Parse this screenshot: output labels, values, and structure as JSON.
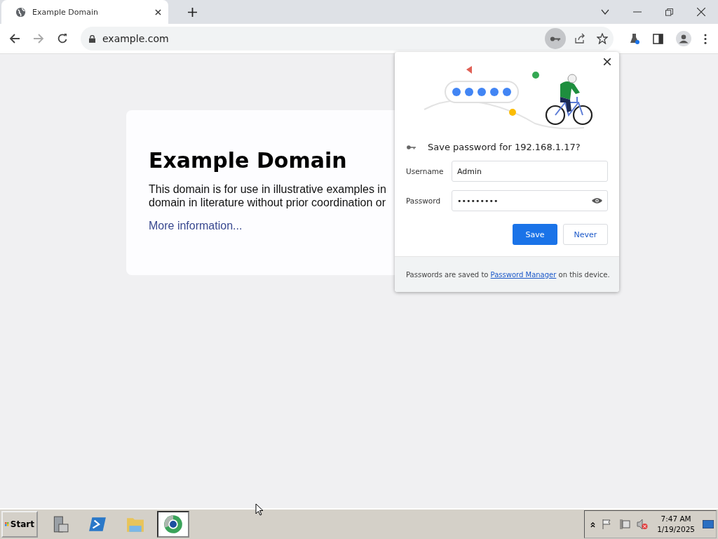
{
  "browser": {
    "tabs": [
      {
        "title": "Example Domain",
        "selected": true
      }
    ],
    "address": "example.com",
    "key_icon_active": true
  },
  "page": {
    "heading": "Example Domain",
    "paragraph_lines": [
      "This domain is for use in illustrative examples in",
      "domain in literature without prior coordination or"
    ],
    "link": "More information..."
  },
  "password_bubble": {
    "title": "Save password for 192.168.1.17?",
    "fields": [
      {
        "label": "Username",
        "value": "Admin",
        "kind": "text"
      },
      {
        "label": "Password",
        "value": "•••••••••",
        "kind": "password"
      }
    ],
    "buttons": [
      {
        "label": "Save",
        "kind": "primary"
      },
      {
        "label": "Never",
        "kind": "secondary"
      }
    ],
    "footer": {
      "before": "Passwords are saved to ",
      "link": "Password Manager",
      "after": " on this device."
    }
  },
  "taskbar": {
    "start": "Start",
    "apps": [
      {
        "kind": "server",
        "selected": false
      },
      {
        "kind": "powershell",
        "selected": false
      },
      {
        "kind": "explorer",
        "selected": false
      },
      {
        "kind": "browser",
        "selected": true
      }
    ],
    "time": "7:47 AM",
    "date": "1/19/2025"
  }
}
